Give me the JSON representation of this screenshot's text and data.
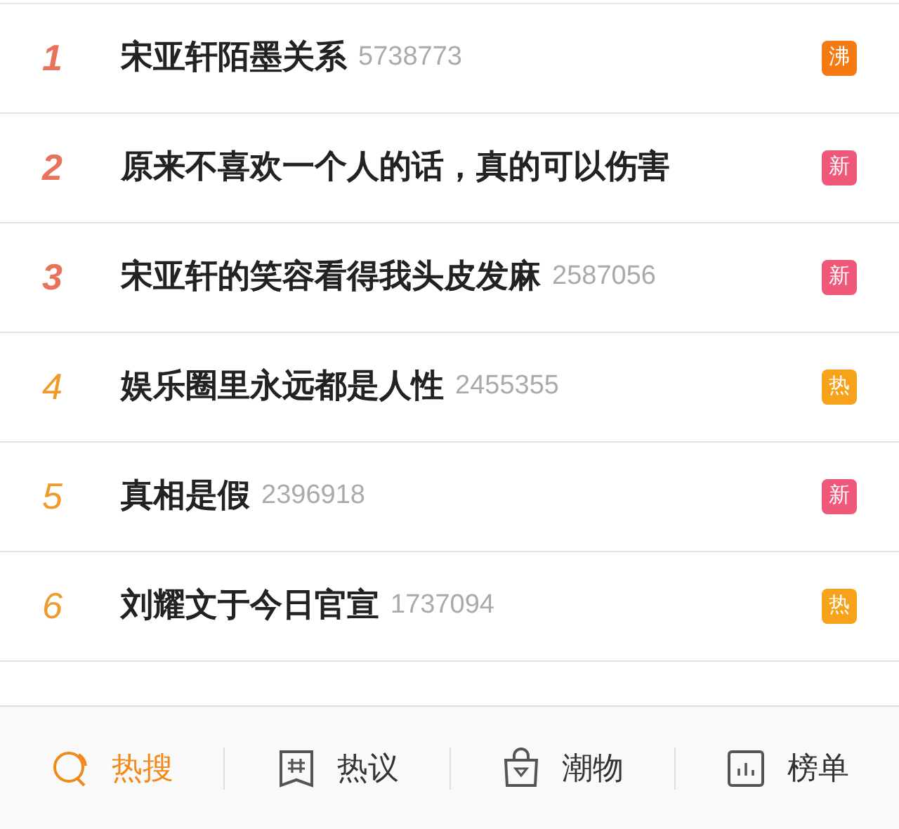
{
  "hot_list": [
    {
      "rank": "1",
      "title": "宋亚轩陌墨关系",
      "count": "5738773",
      "badge": {
        "kind": "boil",
        "label": "沸"
      }
    },
    {
      "rank": "2",
      "title": "原来不喜欢一个人的话，真的可以伤害",
      "badge": {
        "kind": "new",
        "label": "新"
      }
    },
    {
      "rank": "3",
      "title": "宋亚轩的笑容看得我头皮发麻",
      "count": "2587056",
      "badge": {
        "kind": "new",
        "label": "新"
      }
    },
    {
      "rank": "4",
      "title": "娱乐圈里永远都是人性",
      "count": "2455355",
      "badge": {
        "kind": "hot",
        "label": "热"
      }
    },
    {
      "rank": "5",
      "title": "真相是假",
      "count": "2396918",
      "badge": {
        "kind": "new",
        "label": "新"
      }
    },
    {
      "rank": "6",
      "title": "刘耀文于今日官宣",
      "count": "1737094",
      "badge": {
        "kind": "hot",
        "label": "热"
      }
    }
  ],
  "bottom_tabs": [
    {
      "kind": "search",
      "label": "热搜",
      "selected": true
    },
    {
      "kind": "topic",
      "label": "热议",
      "selected": false
    },
    {
      "kind": "shop",
      "label": "潮物",
      "selected": false
    },
    {
      "kind": "chart",
      "label": "榜单",
      "selected": false
    }
  ]
}
